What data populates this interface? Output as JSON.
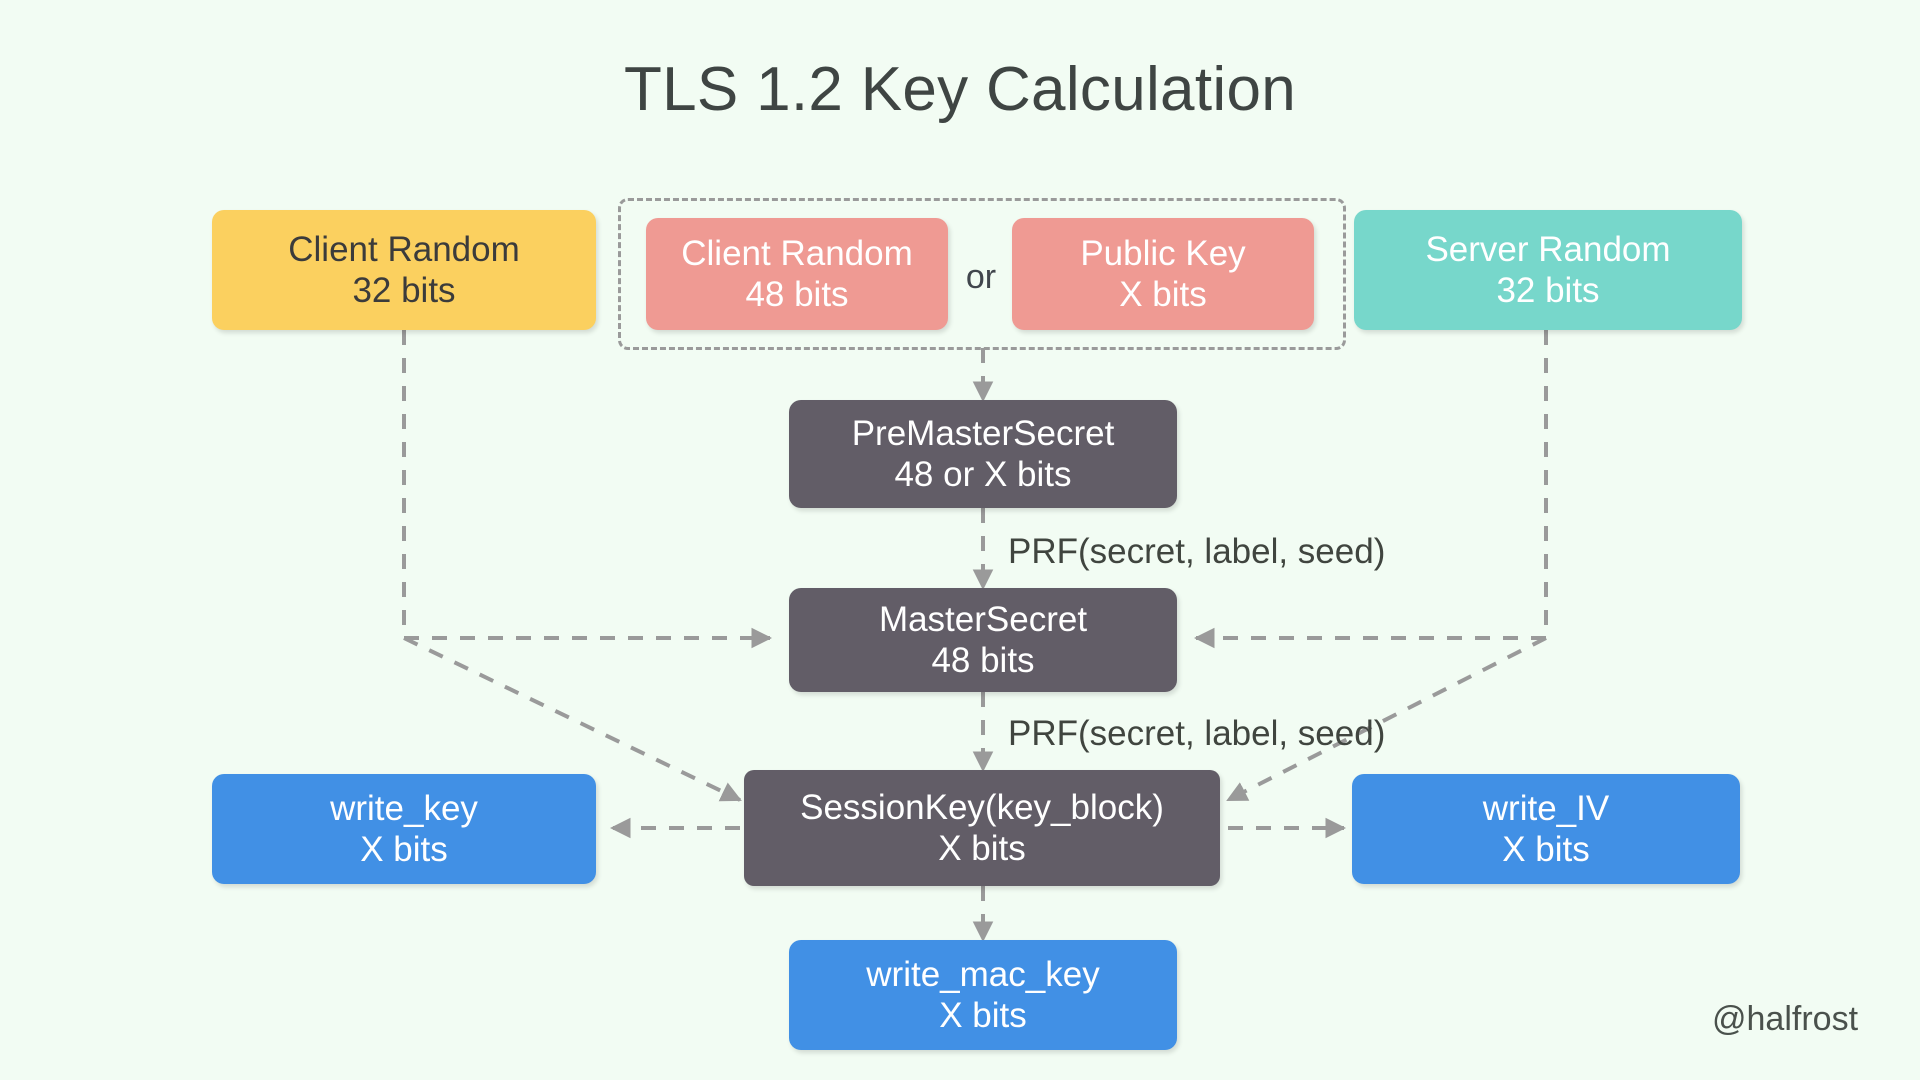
{
  "page": {
    "title": "TLS 1.2 Key Calculation",
    "background_color": "#f2fcf3",
    "watermark": "@halfrost"
  },
  "colors": {
    "yellow": "#fbd05f",
    "pink": "#ef9a93",
    "teal": "#77d7cb",
    "gray": "#625d67",
    "blue": "#4190e5",
    "arrow": "#9a9a9a",
    "title_text": "#3f4543"
  },
  "nodes": {
    "client_random_32": {
      "line1": "Client Random",
      "line2": "32 bits",
      "color": "yellow"
    },
    "client_random_48": {
      "line1": "Client Random",
      "line2": "48 bits",
      "color": "pink"
    },
    "public_key": {
      "line1": "Public Key",
      "line2": "X bits",
      "color": "pink"
    },
    "server_random_32": {
      "line1": "Server Random",
      "line2": "32 bits",
      "color": "teal"
    },
    "premastersecret": {
      "line1": "PreMasterSecret",
      "line2": "48 or X bits",
      "color": "gray"
    },
    "mastersecret": {
      "line1": "MasterSecret",
      "line2": "48 bits",
      "color": "gray"
    },
    "sessionkey": {
      "line1": "SessionKey(key_block)",
      "line2": "X bits",
      "color": "gray"
    },
    "write_key": {
      "line1": "write_key",
      "line2": "X bits",
      "color": "blue"
    },
    "write_iv": {
      "line1": "write_IV",
      "line2": "X bits",
      "color": "blue"
    },
    "write_mac_key": {
      "line1": "write_mac_key",
      "line2": "X bits",
      "color": "blue"
    }
  },
  "labels": {
    "or": "or",
    "prf_master": "PRF(secret, label, seed)",
    "prf_session": "PRF(secret, label, seed)"
  }
}
